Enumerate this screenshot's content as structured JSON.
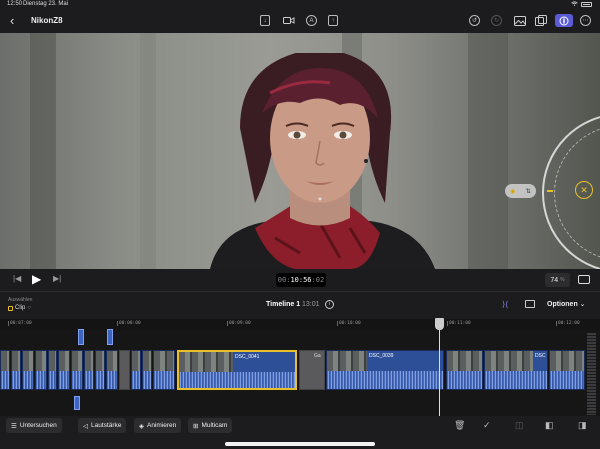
{
  "status": {
    "time": "12:50",
    "date": "Dienstag 23. Mai",
    "battery": "",
    "wifi": "wifi-icon"
  },
  "toolbar": {
    "back_icon": "‹",
    "project_title": "NikonZ8",
    "icons": [
      "import-icon",
      "camera-icon",
      "voiceover-icon",
      "share-icon",
      "undo-icon",
      "redo-icon",
      "photos-icon",
      "browser-icon",
      "inspector-icon",
      "more-icon"
    ]
  },
  "viewer": {
    "dial_close": "✕",
    "pill_left": "◉",
    "pill_right": "⇅"
  },
  "transport": {
    "timecode_prefix": "00:",
    "timecode_main": "10:56",
    "timecode_frames": ":02",
    "zoom_value": "74",
    "zoom_unit": "%"
  },
  "timeline_header": {
    "selection_label": "Auswählen",
    "selection_value": "Clip",
    "title": "Timeline 1",
    "duration": "13:01",
    "options_label": "Optionen"
  },
  "ruler": {
    "ticks": [
      "00:07:00",
      "00:08:00",
      "00:09:00",
      "00:10:00",
      "00:11:00",
      "00:12:00"
    ]
  },
  "clips": {
    "selected_name": "DSC_0041",
    "gap_name": "Ga",
    "clip2_name": "DSC_0039",
    "clip3_name": "DSC"
  },
  "bottom": {
    "inspect_label": "Untersuchen",
    "volume_label": "Lautstärke",
    "animate_label": "Animieren",
    "multicam_label": "Multicam"
  },
  "colors": {
    "accent": "#5b5bd6",
    "selection": "#e8c02b",
    "clip": "#2d4f97"
  }
}
